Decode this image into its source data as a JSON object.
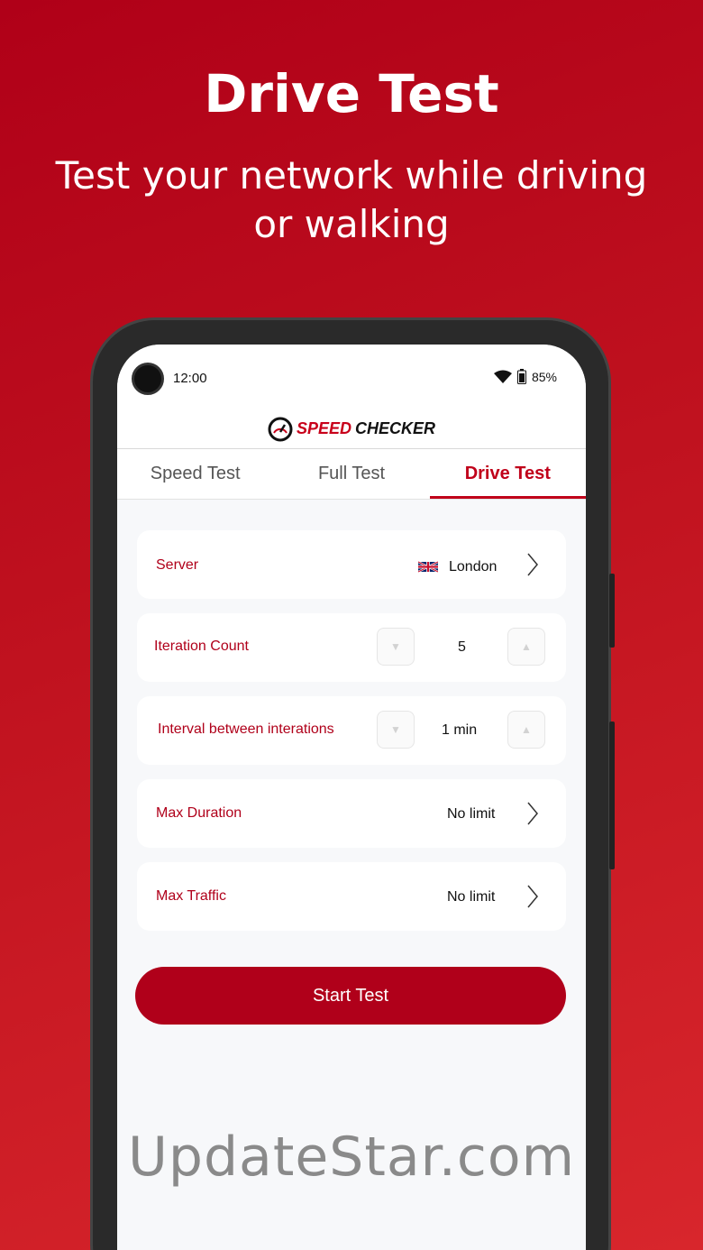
{
  "promo": {
    "title": "Drive Test",
    "subtitle": "Test your network while driving or walking"
  },
  "status_bar": {
    "time": "12:00",
    "battery": "85%"
  },
  "app": {
    "logo_part1": "SPEED",
    "logo_part2": "CHECKER"
  },
  "tabs": [
    {
      "label": "Speed Test"
    },
    {
      "label": "Full Test"
    },
    {
      "label": "Drive Test",
      "active": true
    }
  ],
  "settings": {
    "server": {
      "label": "Server",
      "value": "London"
    },
    "iteration_count": {
      "label": "Iteration Count",
      "value": "5"
    },
    "interval": {
      "label": "Interval between interations",
      "value": "1 min"
    },
    "max_duration": {
      "label": "Max Duration",
      "value": "No limit"
    },
    "max_traffic": {
      "label": "Max Traffic",
      "value": "No limit"
    }
  },
  "start_button": "Start Test",
  "watermark": "UpdateStar.com",
  "colors": {
    "accent": "#b0001a",
    "background": "#c0121f"
  }
}
